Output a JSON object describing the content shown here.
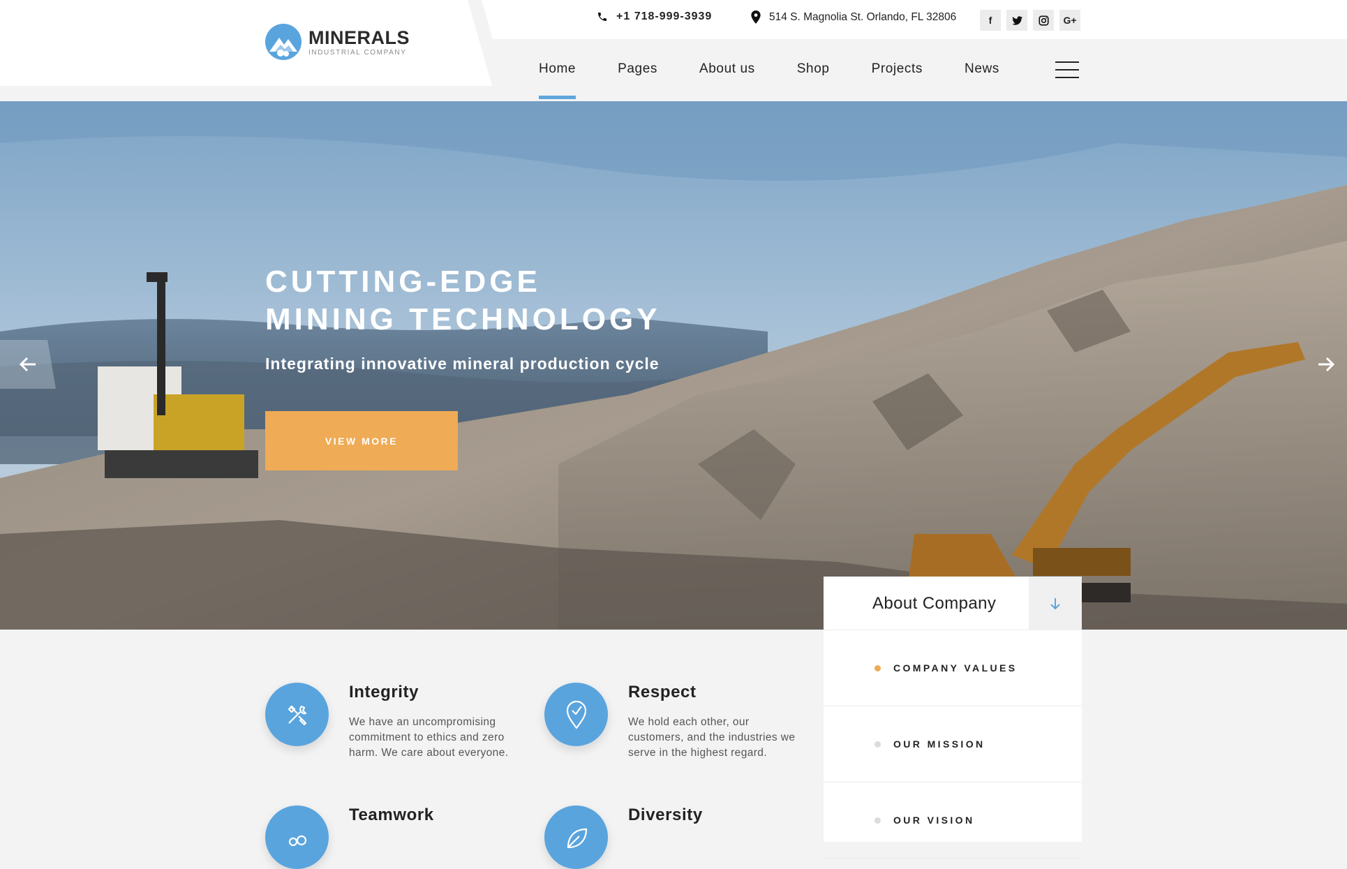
{
  "brand": {
    "name": "MINERALS",
    "tagline": "INDUSTRIAL COMPANY"
  },
  "contact": {
    "phone": "+1 718-999-3939",
    "address": "514 S. Magnolia St. Orlando, FL 32806"
  },
  "social": [
    {
      "icon": "facebook-icon",
      "glyph": "f"
    },
    {
      "icon": "twitter-icon",
      "glyph": "t"
    },
    {
      "icon": "instagram-icon",
      "glyph": "◎"
    },
    {
      "icon": "google-plus-icon",
      "glyph": "G+"
    }
  ],
  "nav": {
    "items": [
      {
        "label": "Home",
        "active": true
      },
      {
        "label": "Pages"
      },
      {
        "label": "About us"
      },
      {
        "label": "Shop"
      },
      {
        "label": "Projects"
      },
      {
        "label": "News"
      }
    ]
  },
  "hero": {
    "title_line1": "CUTTING-EDGE",
    "title_line2": "MINING TECHNOLOGY",
    "subtitle": "Integrating innovative mineral production cycle",
    "button": "VIEW MORE"
  },
  "values": [
    {
      "title": "Integrity",
      "text": "We have an uncompromising commitment to ethics and zero harm. We care about everyone.",
      "icon": "tools-icon"
    },
    {
      "title": "Respect",
      "text": "We hold each other, our customers, and the industries we serve in the highest regard.",
      "icon": "map-pin-check-icon"
    },
    {
      "title": "Teamwork",
      "text": "",
      "icon": "people-icon"
    },
    {
      "title": "Diversity",
      "text": "",
      "icon": "leaf-icon"
    }
  ],
  "about": {
    "title": "About Company",
    "items": [
      {
        "label": "COMPANY VALUES",
        "active": true
      },
      {
        "label": "OUR MISSION"
      },
      {
        "label": "OUR VISION"
      }
    ]
  },
  "colors": {
    "accent_blue": "#5aa4de",
    "accent_orange": "#efab56",
    "background": "#f3f3f3"
  }
}
